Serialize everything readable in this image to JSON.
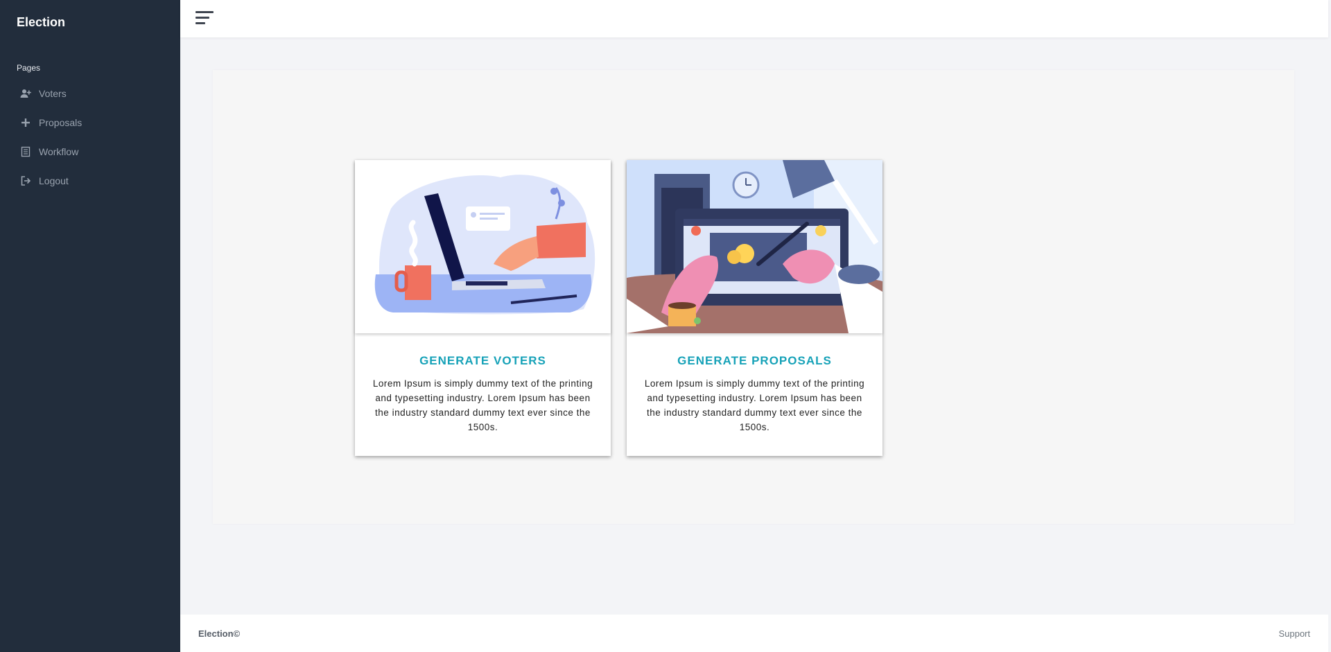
{
  "app": {
    "title": "Election"
  },
  "sidebar": {
    "section_label": "Pages",
    "items": [
      {
        "label": "Voters",
        "icon": "user-plus-icon"
      },
      {
        "label": "Proposals",
        "icon": "plus-icon"
      },
      {
        "label": "Workflow",
        "icon": "list-icon"
      },
      {
        "label": "Logout",
        "icon": "logout-icon"
      }
    ]
  },
  "cards": [
    {
      "title": "GENERATE VOTERS",
      "description": "Lorem Ipsum is simply dummy text of the printing and typesetting industry. Lorem Ipsum has been the industry standard dummy text ever since the 1500s."
    },
    {
      "title": "GENERATE PROPOSALS",
      "description": "Lorem Ipsum is simply dummy text of the printing and typesetting industry. Lorem Ipsum has been the industry standard dummy text ever since the 1500s."
    }
  ],
  "footer": {
    "brand": "Election©",
    "support": "Support"
  },
  "colors": {
    "sidebar": "#222d3c",
    "accent": "#17a2b8",
    "panel": "#f6f6f6"
  }
}
